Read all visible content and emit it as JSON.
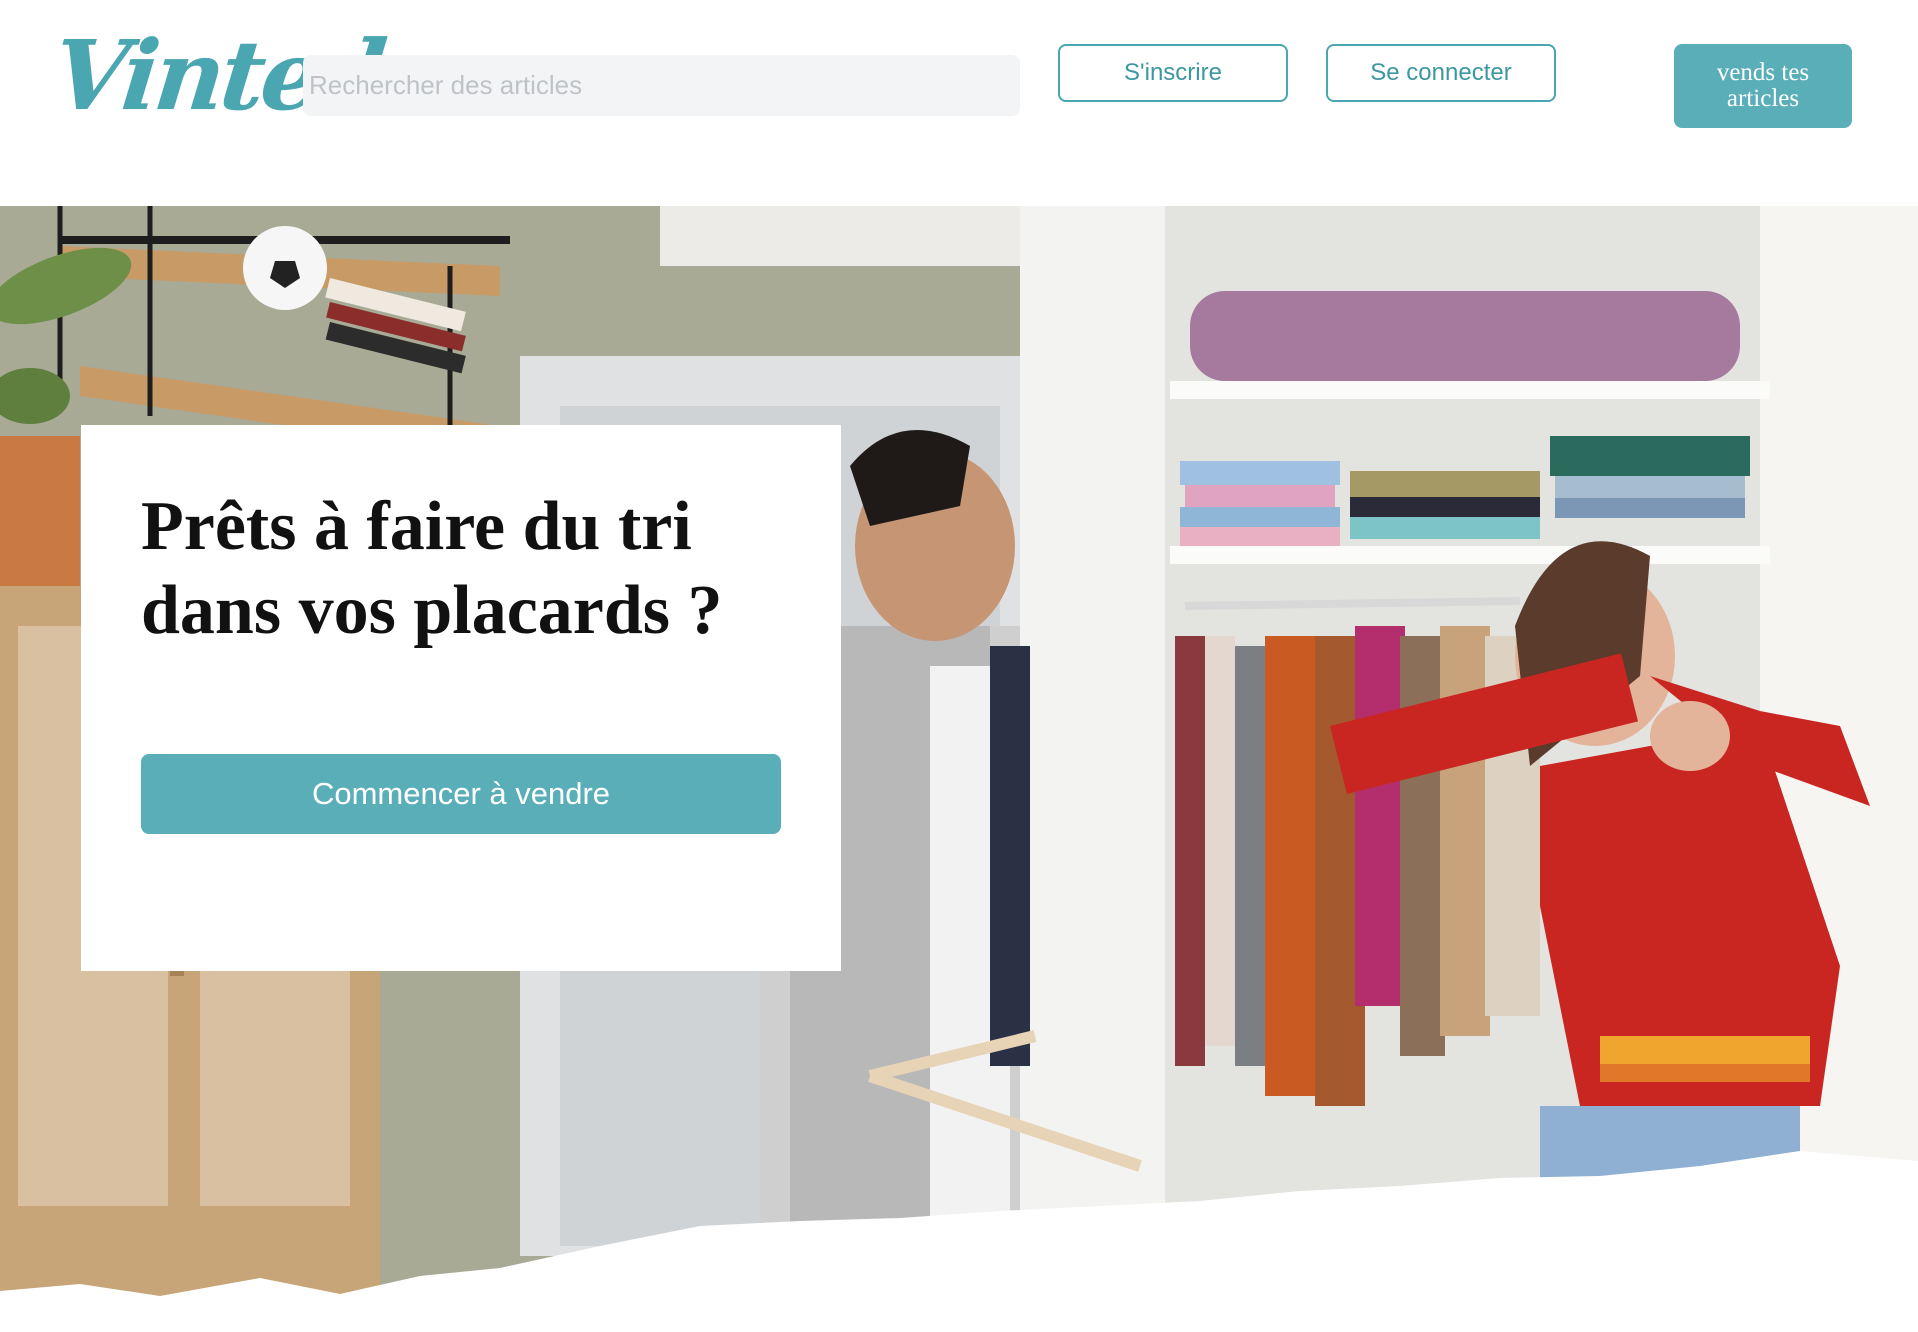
{
  "header": {
    "logo_text": "Vinted",
    "search": {
      "placeholder": "Rechercher des articles",
      "value": ""
    },
    "signup_label": "S'inscrire",
    "login_label": "Se connecter",
    "sell_label": "vends tes articles"
  },
  "hero": {
    "title": "Prêts à faire du tri dans vos placards ?",
    "cta_label": "Commencer à vendre"
  },
  "colors": {
    "brand": "#4aa7b1",
    "button_fill": "#5aaeb8",
    "search_bg": "#f3f4f5"
  },
  "icons": [
    "vinted-logo"
  ]
}
